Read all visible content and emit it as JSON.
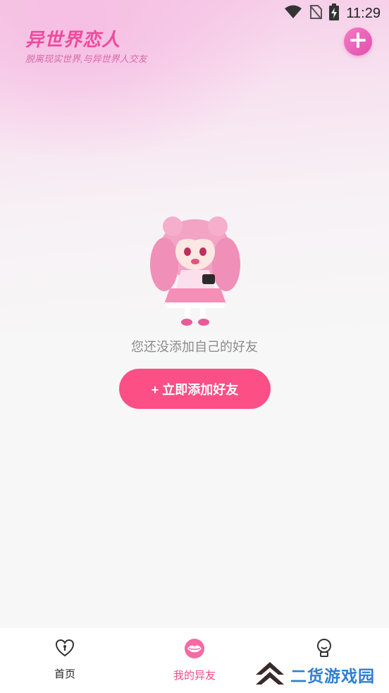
{
  "status_bar": {
    "time": "11:29",
    "icons": [
      "wifi-icon",
      "no-sim-icon",
      "battery-charging-icon"
    ]
  },
  "header": {
    "title": "异世界恋人",
    "subtitle": "脱离现实世界,与异世界人交友",
    "add_icon": "plus-icon"
  },
  "empty_state": {
    "illustration": "anime-girl-mascot",
    "message": "您还没添加自己的好友",
    "button_label": "+ 立即添加好友"
  },
  "tabbar": {
    "tabs": [
      {
        "label": "首页",
        "icon": "heart-lock-icon",
        "active": false
      },
      {
        "label": "我的异友",
        "icon": "lips-icon",
        "active": true
      },
      {
        "label": "",
        "icon": "lightbulb-icon",
        "active": false
      }
    ]
  },
  "watermark": {
    "text": "二货游戏园"
  },
  "colors": {
    "accent": "#fb4f86",
    "title_pink": "#ef4a9c",
    "active_tab": "#f04b88",
    "watermark_blue": "#2f7fcf"
  }
}
